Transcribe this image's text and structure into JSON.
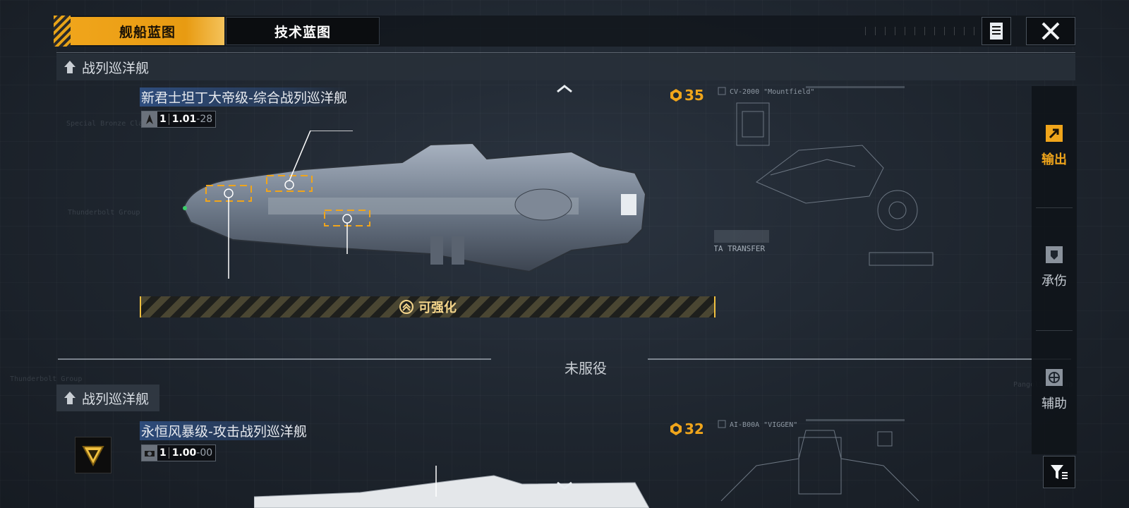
{
  "tabs": [
    {
      "label": "舰船蓝图",
      "active": true
    },
    {
      "label": "技术蓝图",
      "active": false
    }
  ],
  "colors": {
    "accent": "#f0a51b",
    "background": "#1e252e",
    "title_highlight": "#3c6ebe"
  },
  "icons": {
    "list": "document-list-icon",
    "close": "close-icon",
    "filter": "filter-icon",
    "class": "ship-class-icon",
    "cost": "cost-icon",
    "upgrade": "upgrade-chevron-icon"
  },
  "sections": {
    "active_header": "战列巡洋舰",
    "inactive_header": "战列巡洋舰",
    "divider_label": "未服役"
  },
  "ships": [
    {
      "name": "新君士坦丁大帝级-综合战列巡洋舰",
      "tier": "1",
      "level_main": "1.01",
      "level_suffix": "-28",
      "cost": "35",
      "upgrade_label": "可强化",
      "blueprint_code": "CV-2000 \"Mountfield\"",
      "blueprint_note": "DATA TRANSFER"
    },
    {
      "name": "永恒风暴级-攻击战列巡洋舰",
      "tier": "1",
      "level_main": "1.00",
      "level_suffix": "-00",
      "cost": "32",
      "blueprint_code": "AI-B00A \"VIGGEN\""
    }
  ],
  "roles": [
    {
      "label": "输出",
      "icon": "arrow-out-icon",
      "active": true
    },
    {
      "label": "承伤",
      "icon": "shield-icon",
      "active": false
    },
    {
      "label": "辅助",
      "icon": "support-icon",
      "active": false
    }
  ]
}
